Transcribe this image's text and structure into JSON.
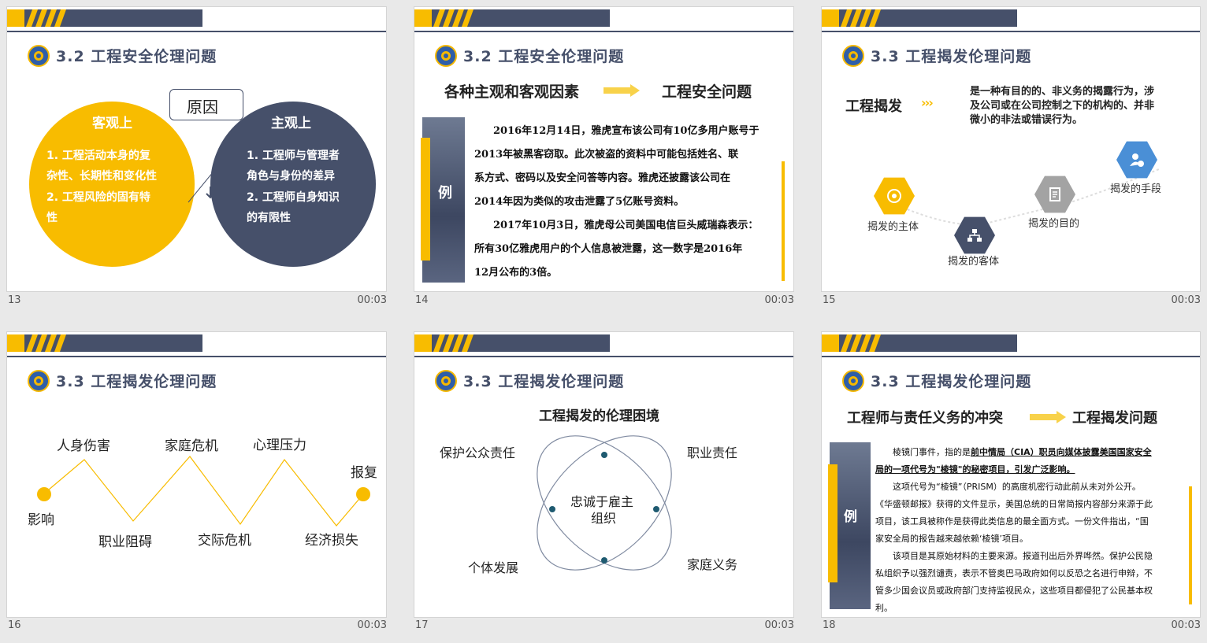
{
  "colors": {
    "yellow": "#f8bc00",
    "navy": "#46506a",
    "panel": "#e9e9e9"
  },
  "slides": [
    {
      "num": "13",
      "time": "00:03",
      "title": "3.2 工程安全伦理问题",
      "reason": "原因",
      "left_head": "客观上",
      "left_l1": "1. 工程活动本身的复",
      "left_l2": "杂性、长期性和变化性",
      "left_l3": "2. 工程风险的固有特",
      "left_l4": "性",
      "right_head": "主观上",
      "right_l1": "1. 工程师与管理者",
      "right_l2": "角色与身份的差异",
      "right_l3": "2. 工程师自身知识",
      "right_l4": "的有限性"
    },
    {
      "num": "14",
      "time": "00:03",
      "title": "3.2 工程安全伦理问题",
      "left": "各种主观和客观因素",
      "right": "工程安全问题",
      "example": "例",
      "p1": "2016年12月14日，雅虎宣布该公司有10亿多用户账号于",
      "p2": "2013年被黑客窃取。此次被盗的资料中可能包括姓名、联",
      "p3": "系方式、密码以及安全问答等内容。雅虎还披露该公司在",
      "p4": "2014年因为类似的攻击泄露了5亿账号资料。",
      "p5": "2017年10月3日，雅虎母公司美国电信巨头威瑞森表示：",
      "p6": "所有30亿雅虎用户的个人信息被泄露，这一数字是2016年",
      "p7": "12月公布的3倍。"
    },
    {
      "num": "15",
      "time": "00:03",
      "title": "3.3 工程揭发伦理问题",
      "term": "工程揭发",
      "def1": "是一种有目的的、非义务的揭露行为，涉",
      "def2": "及公司或在公司控制之下的机构的、并非",
      "def3": "微小的非法或错误行为。",
      "n1": "揭发的主体",
      "n2": "揭发的客体",
      "n3": "揭发的目的",
      "n4": "揭发的手段"
    },
    {
      "num": "16",
      "time": "00:03",
      "title": "3.3 工程揭发伦理问题",
      "top1": "人身伤害",
      "top2": "家庭危机",
      "top3": "心理压力",
      "top4": "报复",
      "bot0": "影响",
      "bot1": "职业阻碍",
      "bot2": "交际危机",
      "bot3": "经济损失"
    },
    {
      "num": "17",
      "time": "00:03",
      "title": "3.3 工程揭发伦理问题",
      "heading": "工程揭发的伦理困境",
      "tl": "保护公众责任",
      "tr": "职业责任",
      "bl": "个体发展",
      "br": "家庭义务",
      "c1": "忠诚于雇主",
      "c2": "组织"
    },
    {
      "num": "18",
      "time": "00:03",
      "title": "3.3 工程揭发伦理问题",
      "left": "工程师与责任义务的冲突",
      "right": "工程揭发问题",
      "example": "例",
      "a1": "棱镜门事件，指的是",
      "a1b": "前中情局（CIA）职员向媒体披露美国国家安全",
      "a2b": "局的一项代号为\"棱镜\"的秘密项目，引发广泛影响。",
      "b1": "这项代号为“棱镜”（PRISM）的高度机密行动此前从未对外公开。",
      "b2": "《华盛顿邮报》获得的文件显示，美国总统的日常简报内容部分来源于此",
      "b3": "项目，该工具被称作是获得此类信息的最全面方式。一份文件指出，“国",
      "b4": "家安全局的报告越来越依赖‘棱镜’项目。",
      "c1": "该项目是其原始材料的主要来源。报道刊出后外界哗然。保护公民隐",
      "c2": "私组织予以强烈谴责，表示不管奥巴马政府如何以反恐之名进行申辩，不",
      "c3": "管多少国会议员或政府部门支持监视民众，这些项目都侵犯了公民基本权",
      "c4": "利。"
    }
  ]
}
